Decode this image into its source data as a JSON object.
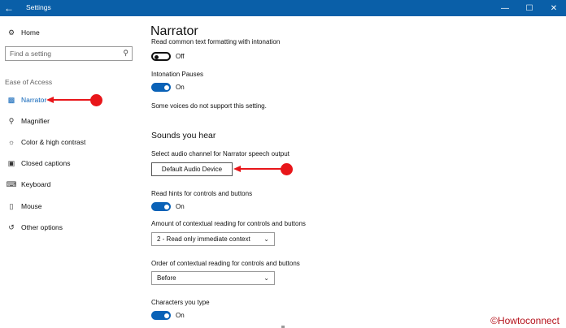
{
  "window": {
    "title": "Settings",
    "back_icon": "back-arrow-icon",
    "controls": {
      "minimize": "—",
      "maximize": "☐",
      "close": "✕"
    }
  },
  "sidebar": {
    "home_label": "Home",
    "search_placeholder": "Find a setting",
    "section_label": "Ease of Access",
    "items": [
      {
        "label": "Narrator",
        "icon": "narrator-icon",
        "active": true
      },
      {
        "label": "Magnifier",
        "icon": "magnifier-icon"
      },
      {
        "label": "Color & high contrast",
        "icon": "color-contrast-icon"
      },
      {
        "label": "Closed captions",
        "icon": "closed-captions-icon"
      },
      {
        "label": "Keyboard",
        "icon": "keyboard-icon"
      },
      {
        "label": "Mouse",
        "icon": "mouse-icon"
      },
      {
        "label": "Other options",
        "icon": "other-options-icon"
      }
    ]
  },
  "content": {
    "title": "Narrator",
    "read_formatting_label": "Read common text formatting with intonation",
    "read_formatting_state": "Off",
    "intonation_pauses_label": "Intonation Pauses",
    "intonation_pauses_state": "On",
    "voices_note": "Some voices do not support this setting.",
    "sounds_heading": "Sounds you hear",
    "audio_channel_label": "Select audio channel for Narrator speech output",
    "audio_channel_button": "Default Audio Device",
    "read_hints_label": "Read hints for controls and buttons",
    "read_hints_state": "On",
    "contextual_amount_label": "Amount of contextual reading for controls and buttons",
    "contextual_amount_value": "2 - Read only immediate context",
    "contextual_order_label": "Order of contextual reading for controls and buttons",
    "contextual_order_value": "Before",
    "characters_label": "Characters you type",
    "characters_state": "On"
  },
  "watermark": "©Howtoconnect",
  "colors": {
    "accent": "#0a62b7",
    "titlebar": "#0a5fa8",
    "annotation": "#e8161a"
  }
}
